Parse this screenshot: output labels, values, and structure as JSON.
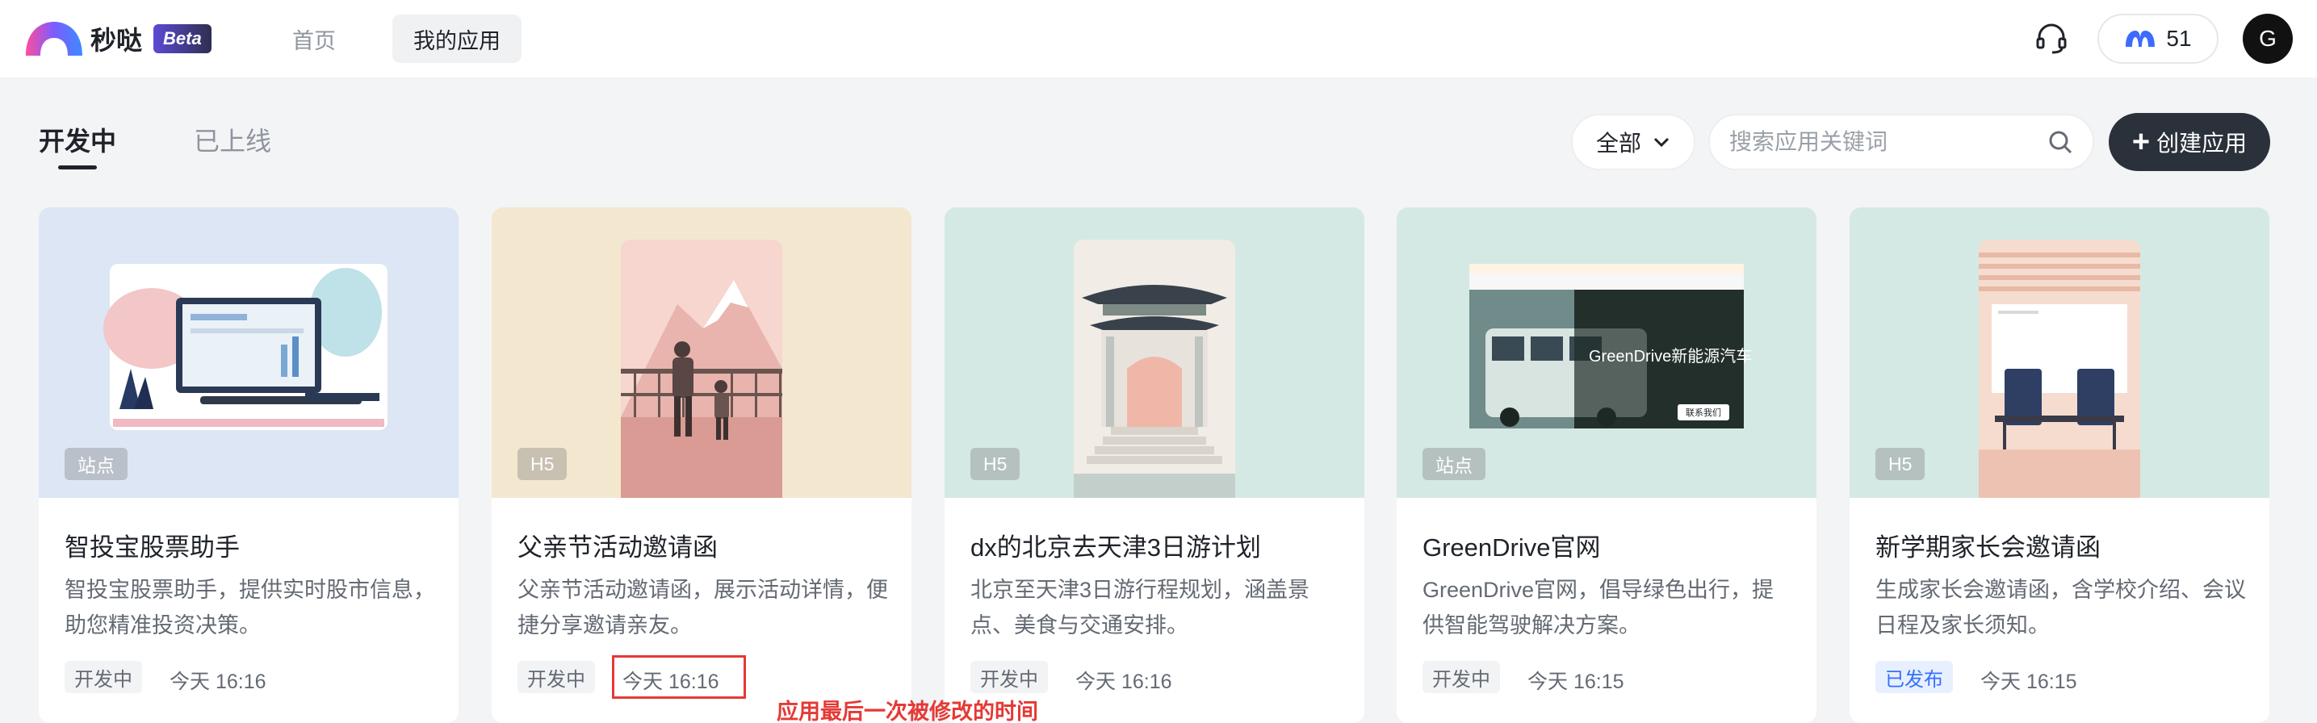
{
  "header": {
    "logo_text": "秒哒",
    "beta_label": "Beta",
    "nav": {
      "home": "首页",
      "my_apps": "我的应用"
    },
    "credits": "51",
    "avatar_initial": "G"
  },
  "tabs": {
    "developing": "开发中",
    "online": "已上线"
  },
  "toolbar": {
    "filter_label": "全部",
    "search_placeholder": "搜索应用关键词",
    "create_label": "创建应用"
  },
  "cards": [
    {
      "type": "站点",
      "title": "智投宝股票助手",
      "desc": "智投宝股票助手，提供实时股市信息，助您精准投资决策。",
      "status": "开发中",
      "time": "今天 16:16",
      "thumb_bg": "#dce6f5"
    },
    {
      "type": "H5",
      "title": "父亲节活动邀请函",
      "desc": "父亲节活动邀请函，展示活动详情，便捷分享邀请亲友。",
      "status": "开发中",
      "time": "今天 16:16",
      "thumb_bg": "#f3e7d0"
    },
    {
      "type": "H5",
      "title": "dx的北京去天津3日游计划",
      "desc": "北京至天津3日游行程规划，涵盖景点、美食与交通安排。",
      "status": "开发中",
      "time": "今天 16:16",
      "thumb_bg": "#d5e9e4"
    },
    {
      "type": "站点",
      "title": "GreenDrive官网",
      "desc": "GreenDrive官网，倡导绿色出行，提供智能驾驶解决方案。",
      "status": "开发中",
      "time": "今天 16:15",
      "thumb_bg": "#d5e9e4",
      "thumb_caption": "GreenDrive新能源汽车",
      "thumb_button": "联系我们"
    },
    {
      "type": "H5",
      "title": "新学期家长会邀请函",
      "desc": "生成家长会邀请函，含学校介绍、会议日程及家长须知。",
      "status": "已发布",
      "time": "今天 16:15",
      "thumb_bg": "#d5e9e4"
    }
  ],
  "annotation": "应用最后一次被修改的时间"
}
